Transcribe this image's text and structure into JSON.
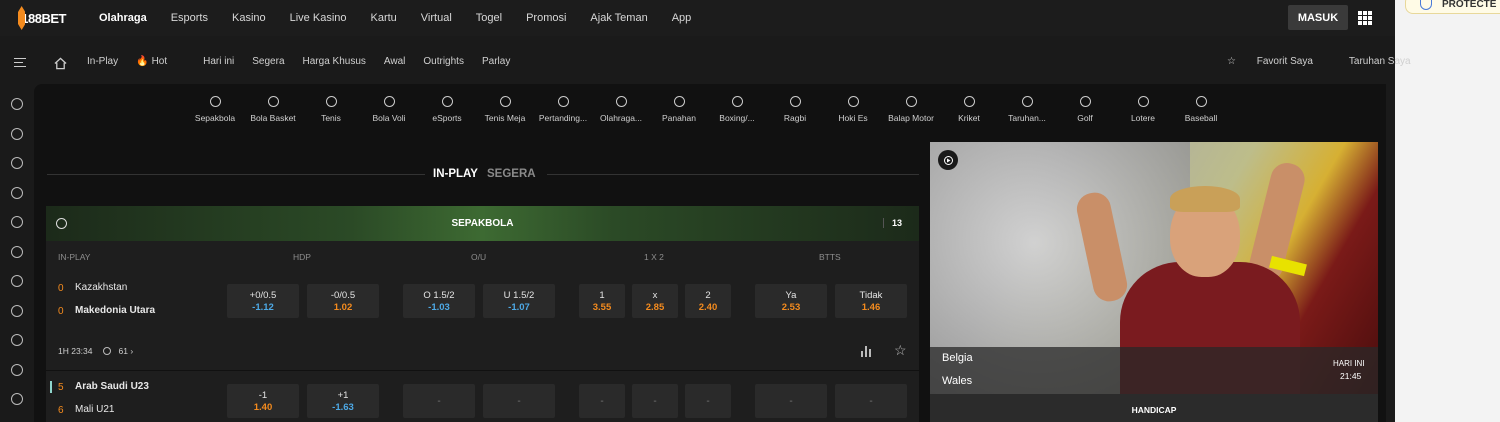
{
  "brand": {
    "logo_text": "188BET",
    "accent": "#f48b1e"
  },
  "topnav": {
    "items": [
      "Olahraga",
      "Esports",
      "Kasino",
      "Live Kasino",
      "Kartu",
      "Virtual",
      "Togel",
      "Promosi",
      "Ajak Teman",
      "App"
    ],
    "active": "Olahraga",
    "login_label": "MASUK"
  },
  "subnav": {
    "items": [
      "In-Play",
      "Hot",
      "Hari ini",
      "Segera",
      "Harga Khusus",
      "Awal",
      "Outrights",
      "Parlay"
    ],
    "right": [
      "Favorit Saya",
      "Taruhan Saya"
    ]
  },
  "sports": [
    "Sepakbola",
    "Bola Basket",
    "Tenis",
    "Bola Voli",
    "eSports",
    "Tenis Meja",
    "Pertanding...",
    "Olahraga...",
    "Panahan",
    "Boxing/...",
    "Ragbi",
    "Hoki Es",
    "Balap Motor",
    "Kriket",
    "Taruhan...",
    "Golf",
    "Lotere",
    "Baseball"
  ],
  "tabs": {
    "inplay": "IN-PLAY",
    "segera": "SEGERA"
  },
  "table": {
    "sport_title": "SEPAKBOLA",
    "count": "13",
    "columns": {
      "inplay": "IN-PLAY",
      "hdp": "HDP",
      "ou": "O/U",
      "x12": "1 X 2",
      "btts": "BTTS"
    },
    "matches": [
      {
        "home": "Kazakhstan",
        "away": "Makedonia Utara",
        "home_score": "0",
        "away_score": "0",
        "hdp": [
          {
            "line": "+0/0.5",
            "odd": "-1.12"
          },
          {
            "line": "-0/0.5",
            "odd": "1.02"
          }
        ],
        "ou": [
          {
            "line": "O 1.5/2",
            "odd": "-1.03"
          },
          {
            "line": "U 1.5/2",
            "odd": "-1.07"
          }
        ],
        "x12": [
          {
            "line": "1",
            "odd": "3.55"
          },
          {
            "line": "x",
            "odd": "2.85"
          },
          {
            "line": "2",
            "odd": "2.40"
          }
        ],
        "btts": [
          {
            "line": "Ya",
            "odd": "2.53"
          },
          {
            "line": "Tidak",
            "odd": "1.46"
          }
        ],
        "time": "1H 23:34",
        "markets": "61"
      },
      {
        "home": "Arab Saudi U23",
        "away": "Mali U21",
        "home_score": "5",
        "away_score": "6",
        "hdp": [
          {
            "line": "-1",
            "odd": "1.40"
          },
          {
            "line": "+1",
            "odd": "-1.63"
          }
        ],
        "empty": "-"
      }
    ]
  },
  "promo": {
    "team1": "Belgia",
    "team2": "Wales",
    "day": "HARI INI",
    "time": "21:45",
    "market": "HANDICAP"
  },
  "extension": {
    "label": "PROTECTE"
  }
}
